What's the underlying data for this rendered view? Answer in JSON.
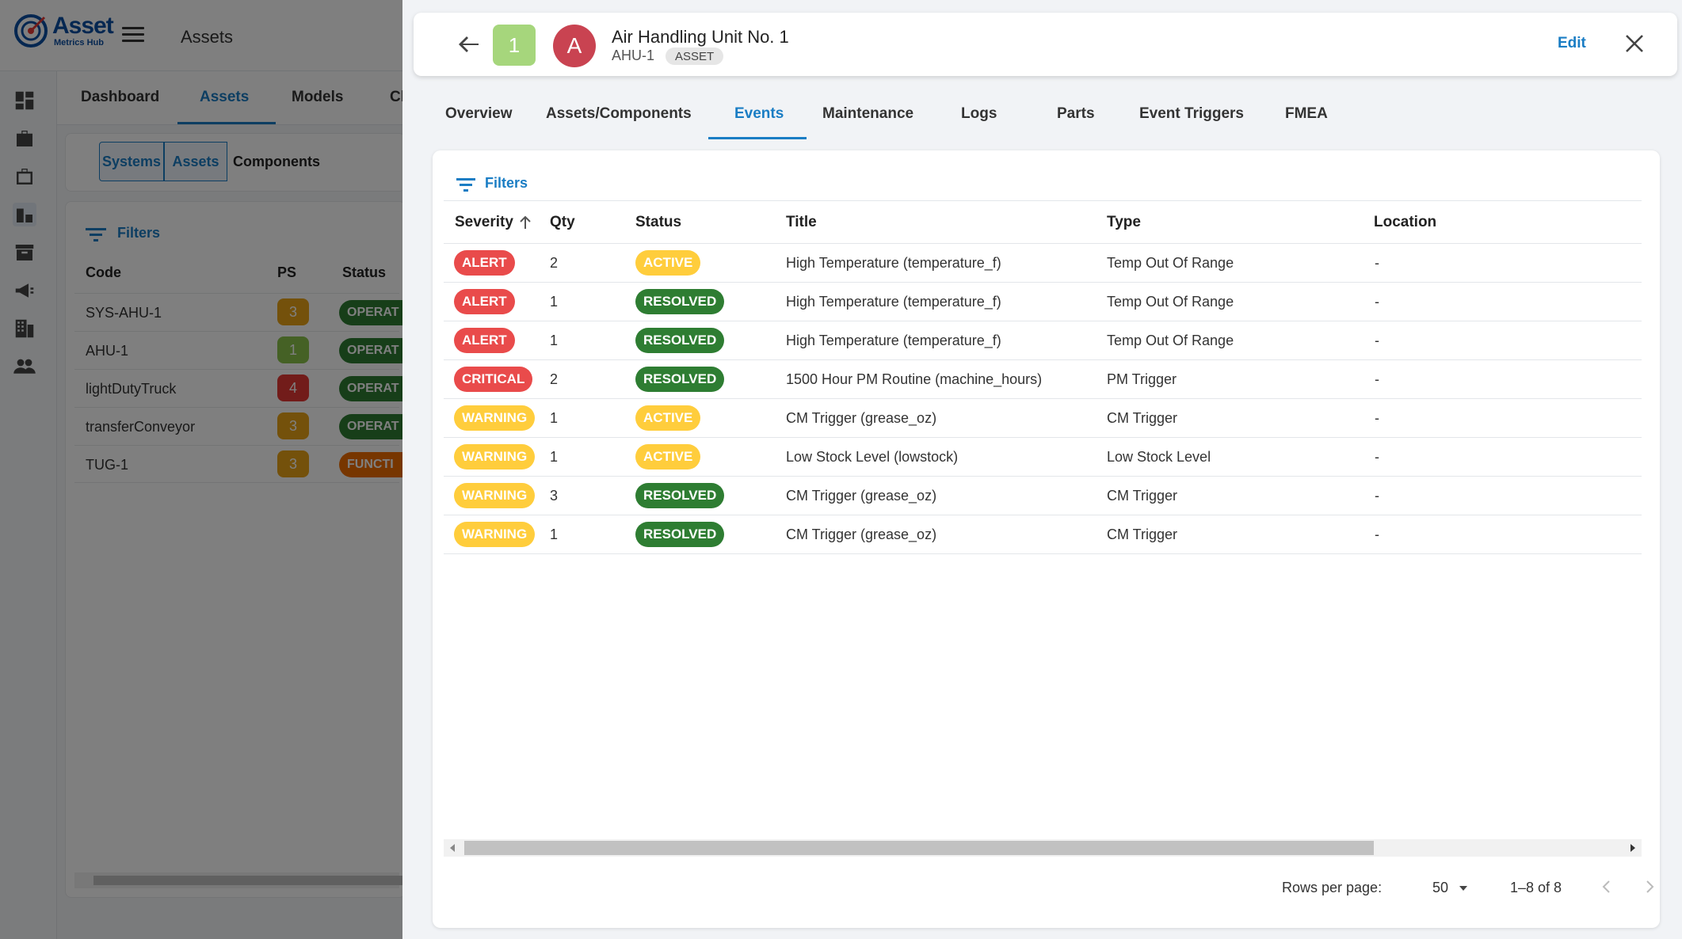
{
  "app": {
    "logo_line1": "Asset",
    "logo_line2": "Metrics Hub",
    "page_title": "Assets"
  },
  "nav": {
    "tabs": [
      {
        "label": "Dashboard"
      },
      {
        "label": "Assets"
      },
      {
        "label": "Models"
      },
      {
        "label": "Cl"
      }
    ],
    "active": "Assets"
  },
  "segments": [
    {
      "label": "Systems"
    },
    {
      "label": "Assets"
    },
    {
      "label": "Components"
    }
  ],
  "bg_table": {
    "filters_label": "Filters",
    "headers": {
      "code": "Code",
      "ps": "PS",
      "status": "Status"
    },
    "rows": [
      {
        "code": "SYS-AHU-1",
        "ps": "3",
        "ps_color": "#e8a317",
        "status": "OPERAT",
        "status_color": "#2e7d32"
      },
      {
        "code": "AHU-1",
        "ps": "1",
        "ps_color": "#8bc34a",
        "status": "OPERAT",
        "status_color": "#2e7d32"
      },
      {
        "code": "lightDutyTruck",
        "ps": "4",
        "ps_color": "#e53935",
        "status": "OPERAT",
        "status_color": "#2e7d32"
      },
      {
        "code": "transferConveyor",
        "ps": "3",
        "ps_color": "#e8a317",
        "status": "OPERAT",
        "status_color": "#2e7d32"
      },
      {
        "code": "TUG-1",
        "ps": "3",
        "ps_color": "#e8a317",
        "status": "FUNCTI",
        "status_color": "#ef6c00"
      }
    ]
  },
  "drawer": {
    "priority_badge": "1",
    "avatar_letter": "A",
    "title": "Air Handling Unit No. 1",
    "code": "AHU-1",
    "type_chip": "ASSET",
    "edit_label": "Edit",
    "tabs": [
      {
        "label": "Overview"
      },
      {
        "label": "Assets/Components"
      },
      {
        "label": "Events"
      },
      {
        "label": "Maintenance"
      },
      {
        "label": "Logs"
      },
      {
        "label": "Parts"
      },
      {
        "label": "Event Triggers"
      },
      {
        "label": "FMEA"
      }
    ],
    "active_tab": "Events",
    "filters_label": "Filters",
    "columns": {
      "severity": "Severity",
      "qty": "Qty",
      "status": "Status",
      "title": "Title",
      "type": "Type",
      "location": "Location"
    },
    "sort": {
      "column": "Severity",
      "direction": "ascending"
    },
    "events": [
      {
        "severity": "ALERT",
        "qty": "2",
        "status": "ACTIVE",
        "title": "High Temperature (temperature_f)",
        "type": "Temp Out Of Range",
        "location": "-"
      },
      {
        "severity": "ALERT",
        "qty": "1",
        "status": "RESOLVED",
        "title": "High Temperature (temperature_f)",
        "type": "Temp Out Of Range",
        "location": "-"
      },
      {
        "severity": "ALERT",
        "qty": "1",
        "status": "RESOLVED",
        "title": "High Temperature (temperature_f)",
        "type": "Temp Out Of Range",
        "location": "-"
      },
      {
        "severity": "CRITICAL",
        "qty": "2",
        "status": "RESOLVED",
        "title": "1500 Hour PM Routine (machine_hours)",
        "type": "PM Trigger",
        "location": "-"
      },
      {
        "severity": "WARNING",
        "qty": "1",
        "status": "ACTIVE",
        "title": "CM Trigger (grease_oz)",
        "type": "CM Trigger",
        "location": "-"
      },
      {
        "severity": "WARNING",
        "qty": "1",
        "status": "ACTIVE",
        "title": "Low Stock Level (lowstock)",
        "type": "Low Stock Level",
        "location": "-"
      },
      {
        "severity": "WARNING",
        "qty": "3",
        "status": "RESOLVED",
        "title": "CM Trigger (grease_oz)",
        "type": "CM Trigger",
        "location": "-"
      },
      {
        "severity": "WARNING",
        "qty": "1",
        "status": "RESOLVED",
        "title": "CM Trigger (grease_oz)",
        "type": "CM Trigger",
        "location": "-"
      }
    ],
    "pagination": {
      "rows_per_page_label": "Rows per page:",
      "rows_per_page": "50",
      "range": "1–8 of 8"
    }
  },
  "colors": {
    "accent": "#1a7dc4",
    "alert": "#e94b4b",
    "warning": "#ffcd3c",
    "resolved": "#2e7d32"
  }
}
